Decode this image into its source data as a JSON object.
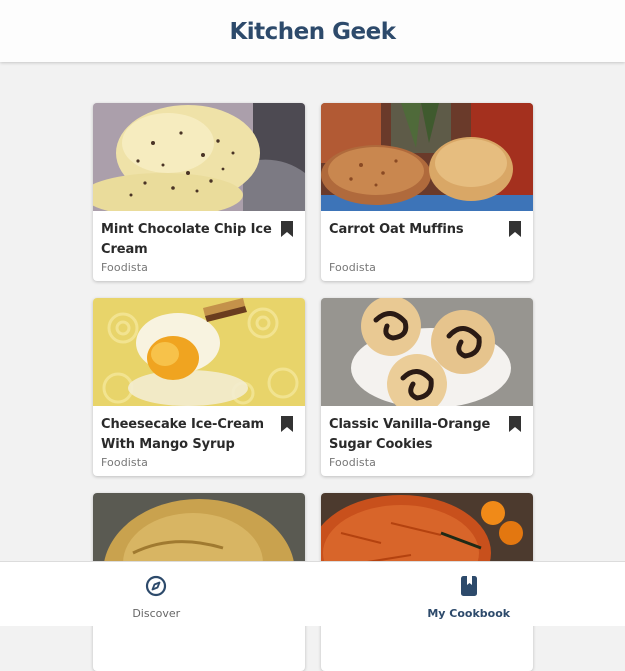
{
  "app": {
    "title": "Kitchen Geek"
  },
  "recipes": [
    {
      "title": "Mint Chocolate Chip Ice Cream",
      "source": "Foodista"
    },
    {
      "title": "Carrot Oat Muffins",
      "source": "Foodista"
    },
    {
      "title": "Cheesecake Ice-Cream With Mango Syrup",
      "source": "Foodista"
    },
    {
      "title": "Classic Vanilla-Orange Sugar Cookies",
      "source": "Foodista"
    }
  ],
  "nav": {
    "items": [
      {
        "label": "Discover",
        "icon": "compass-icon",
        "active": false
      },
      {
        "label": "My Cookbook",
        "icon": "cookbook-icon",
        "active": true
      }
    ]
  },
  "colors": {
    "brand": "#2d4a6b",
    "background": "#f2f2f2",
    "bookmark": "#333333"
  }
}
